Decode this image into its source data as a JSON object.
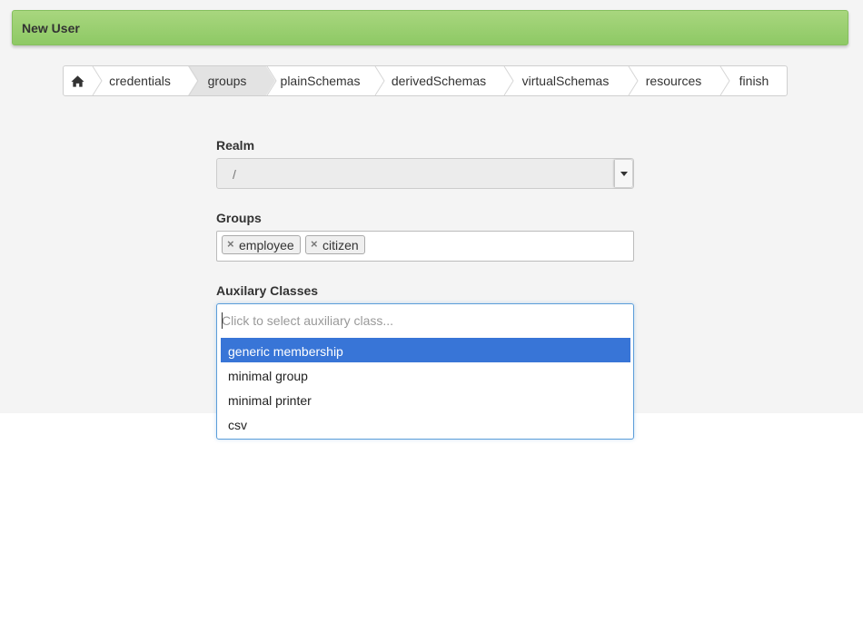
{
  "header": {
    "title": "New User"
  },
  "wizard": {
    "home_icon": "home-icon",
    "steps": [
      {
        "label": "credentials",
        "active": false
      },
      {
        "label": "groups",
        "active": true
      },
      {
        "label": "plainSchemas",
        "active": false
      },
      {
        "label": "derivedSchemas",
        "active": false
      },
      {
        "label": "virtualSchemas",
        "active": false
      },
      {
        "label": "resources",
        "active": false
      },
      {
        "label": "finish",
        "active": false
      }
    ]
  },
  "form": {
    "realm": {
      "label": "Realm",
      "value": "/"
    },
    "groups": {
      "label": "Groups",
      "tags": [
        "employee",
        "citizen"
      ],
      "remove_symbol": "×"
    },
    "auxiliary": {
      "label": "Auxilary Classes",
      "placeholder": "Click to select auxiliary class...",
      "options": [
        "generic membership",
        "minimal group",
        "minimal printer",
        "csv"
      ],
      "highlighted": "generic membership"
    }
  },
  "colors": {
    "header_green": "#8ec965",
    "highlight_blue": "#3875d7",
    "focus_border": "#5b9dd9"
  }
}
